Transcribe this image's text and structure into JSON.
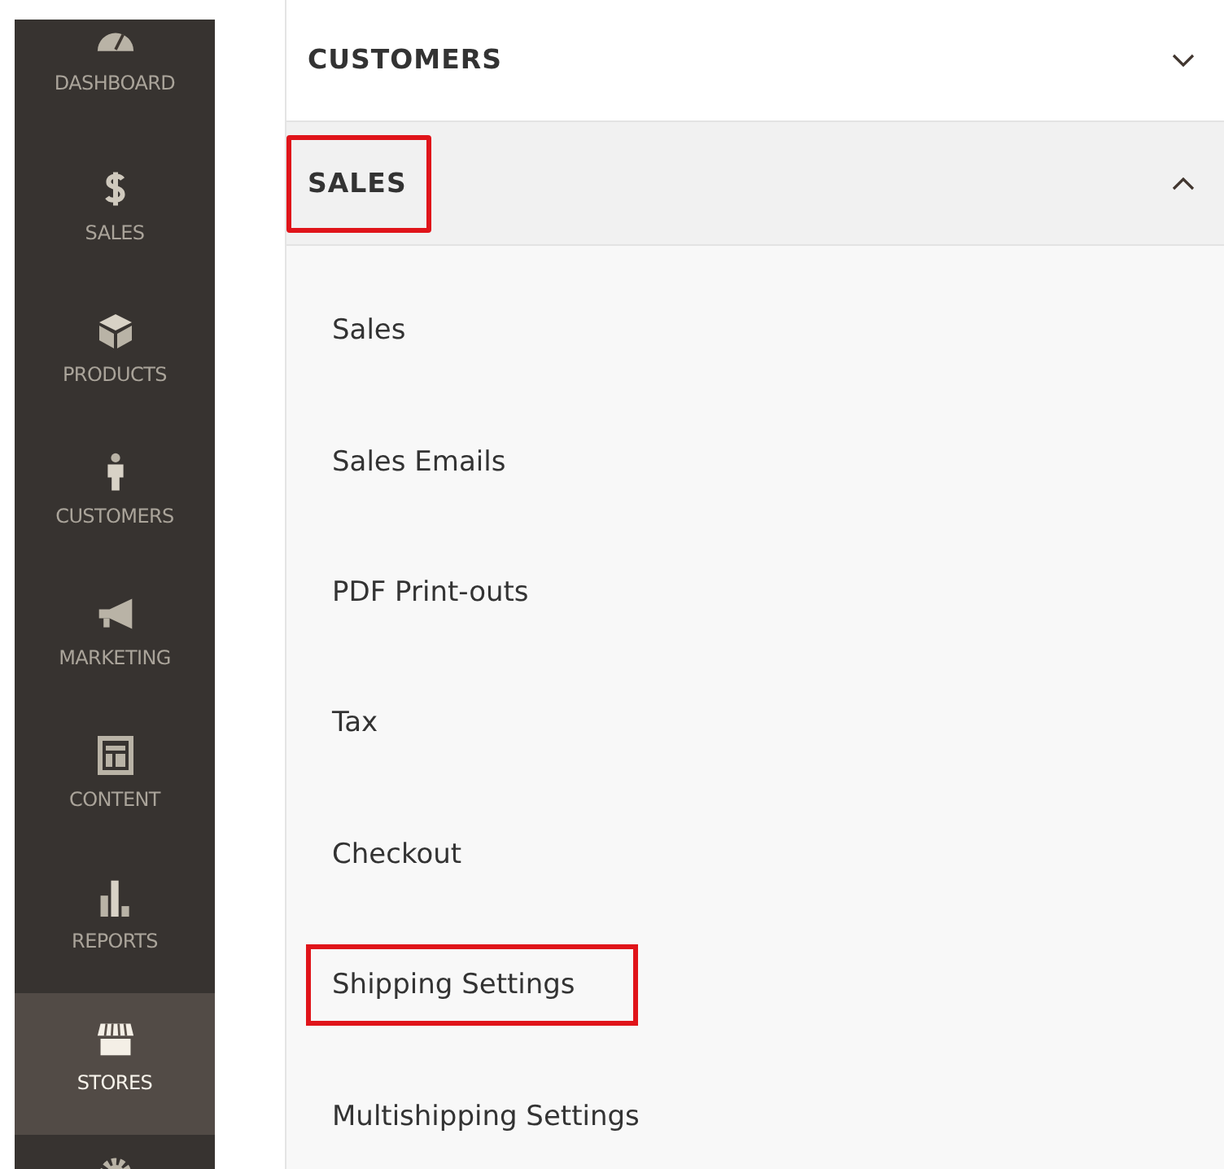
{
  "sidebar": {
    "items": [
      {
        "kind": "dashboard",
        "label": "DASHBOARD",
        "selected": false
      },
      {
        "kind": "dollar",
        "label": "SALES",
        "selected": false
      },
      {
        "kind": "box",
        "label": "PRODUCTS",
        "selected": false
      },
      {
        "kind": "person",
        "label": "CUSTOMERS",
        "selected": false
      },
      {
        "kind": "megaphone",
        "label": "MARKETING",
        "selected": false
      },
      {
        "kind": "layout",
        "label": "CONTENT",
        "selected": false
      },
      {
        "kind": "bars",
        "label": "REPORTS",
        "selected": false
      },
      {
        "kind": "store",
        "label": "STORES",
        "selected": true
      },
      {
        "kind": "gear",
        "selected": false
      }
    ]
  },
  "sections": [
    {
      "title": "CUSTOMERS",
      "expanded": false,
      "highlighted": false
    },
    {
      "title": "SALES",
      "expanded": true,
      "highlighted": true,
      "items": [
        {
          "label": "Sales",
          "highlighted": false
        },
        {
          "label": "Sales Emails",
          "highlighted": false
        },
        {
          "label": "PDF Print-outs",
          "highlighted": false
        },
        {
          "label": "Tax",
          "highlighted": false
        },
        {
          "label": "Checkout",
          "highlighted": false
        },
        {
          "label": "Shipping Settings",
          "highlighted": true
        },
        {
          "label": "Multishipping Settings",
          "highlighted": false
        }
      ]
    }
  ]
}
